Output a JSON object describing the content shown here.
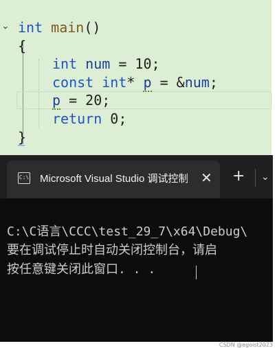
{
  "editor": {
    "code": {
      "l1": {
        "kw": "int",
        "name": "main",
        "rest": "()"
      },
      "l2": "{",
      "l3": {
        "kw": "int",
        "id": "num",
        "rest": " = 10;"
      },
      "l4": {
        "kw1": "const",
        "kw2": "int",
        "star": "* ",
        "p": "p",
        "mid": " = &",
        "id": "num",
        "end": ";"
      },
      "l5": {
        "p": "p",
        "rest": " = 20;"
      },
      "l6": {
        "kw": "return",
        "rest": " 0;"
      },
      "l7": "}"
    },
    "fold_icon": "chevron-down-icon"
  },
  "terminal": {
    "tab_title": "Microsoft Visual Studio 调试控制台",
    "icon_text": "C:\\",
    "close_glyph": "✕",
    "new_tab_glyph": "+",
    "dropdown_glyph": "⌄",
    "output": [
      "C:\\C语言\\CCC\\test_29_7\\x64\\Debug\\",
      "要在调试停止时自动关闭控制台，请启",
      "按任意键关闭此窗口. . ."
    ]
  },
  "watermark": "CSDN @egoist2023"
}
